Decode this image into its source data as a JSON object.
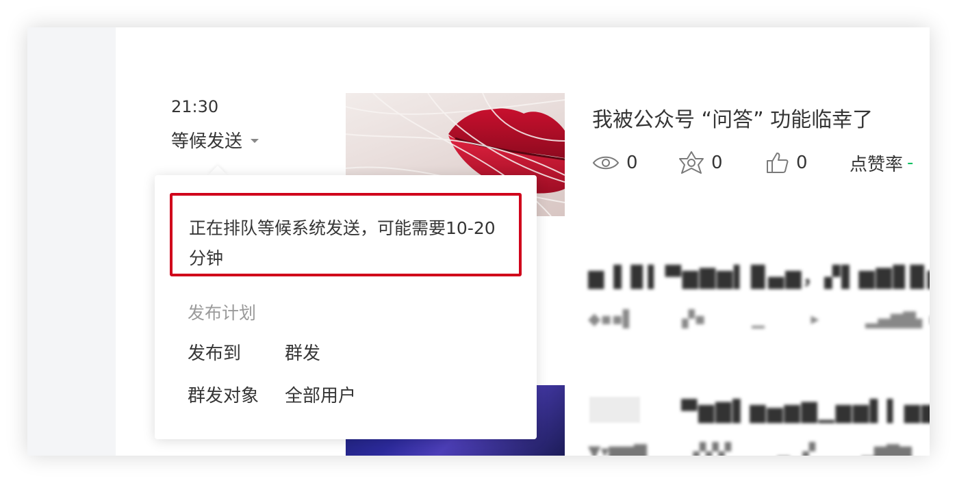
{
  "schedule": {
    "time": "21:30",
    "status": "等候发送"
  },
  "popover": {
    "notice": "正在排队等候系统发送，可能需要10-20分钟",
    "plan_title": "发布计划",
    "publish_to_label": "发布到",
    "publish_to_value": "群发",
    "audience_label": "群发对象",
    "audience_value": "全部用户"
  },
  "article": {
    "title": "我被公众号 “问答” 功能临幸了",
    "views": "0",
    "shares": "0",
    "likes": "0",
    "like_rate_label": "点赞率",
    "like_rate_value": "-"
  },
  "colors": {
    "alert_border": "#d0021b",
    "accent_green": "#07c160",
    "text": "#353535",
    "muted": "#9a9a9a"
  },
  "icons": {
    "views": "eye-icon",
    "shares": "share-icon",
    "likes": "thumbs-up-icon",
    "status": "caret-down-icon"
  }
}
